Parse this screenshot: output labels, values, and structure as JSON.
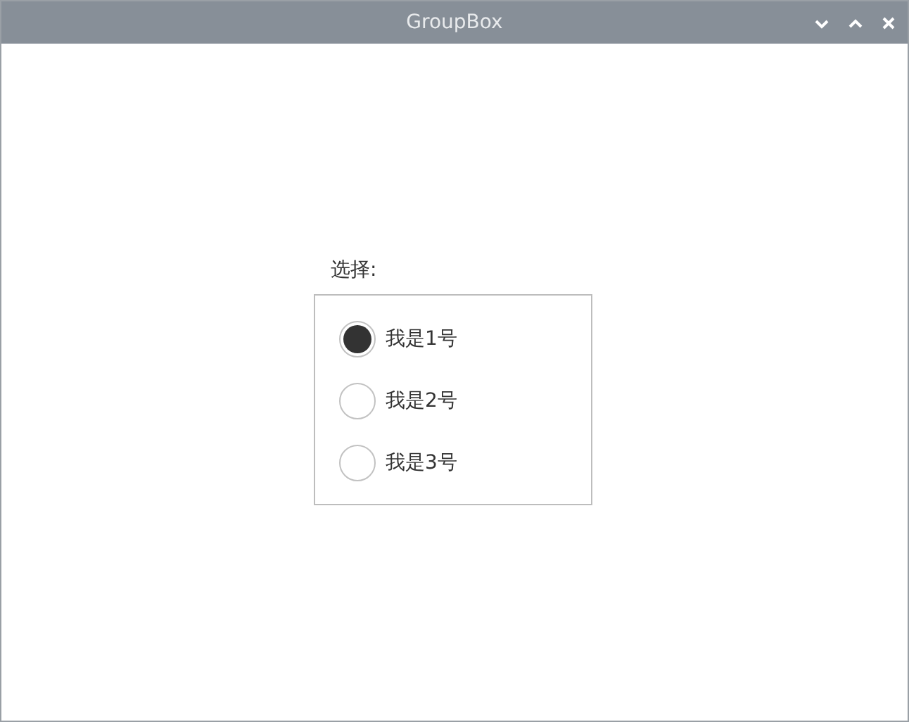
{
  "window": {
    "title": "GroupBox"
  },
  "group": {
    "title": "选择:",
    "options": [
      {
        "label": "我是1号",
        "selected": true
      },
      {
        "label": "我是2号",
        "selected": false
      },
      {
        "label": "我是3号",
        "selected": false
      }
    ]
  }
}
